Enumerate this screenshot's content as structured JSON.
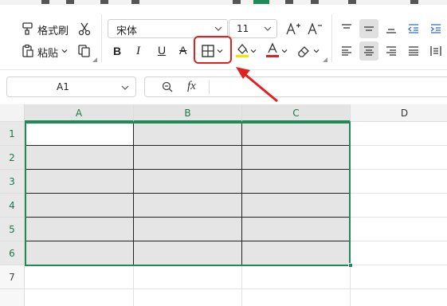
{
  "ribbon": {
    "format_painter_label": "格式刷",
    "paste_label": "粘贴",
    "font_name": "宋体",
    "font_size": "11",
    "bold_label": "B",
    "italic_label": "I",
    "underline_label": "U",
    "strikethrough_label": "A",
    "increase_font_label": "A+",
    "decrease_font_label": "A-",
    "font_color_label": "A",
    "highlight_color": "#f5e400",
    "font_color": "#e02020"
  },
  "formula_bar": {
    "name_box": "A1",
    "fx_label": "fx",
    "formula": ""
  },
  "sheet": {
    "columns": [
      "A",
      "B",
      "C",
      "D"
    ],
    "rows": [
      "1",
      "2",
      "3",
      "4",
      "5",
      "6",
      "7"
    ],
    "selected_range": "A1:C6",
    "active_cell": "A1"
  },
  "annotation": {
    "highlight_color": "#e32020",
    "highlighted_control": "borders-button"
  }
}
